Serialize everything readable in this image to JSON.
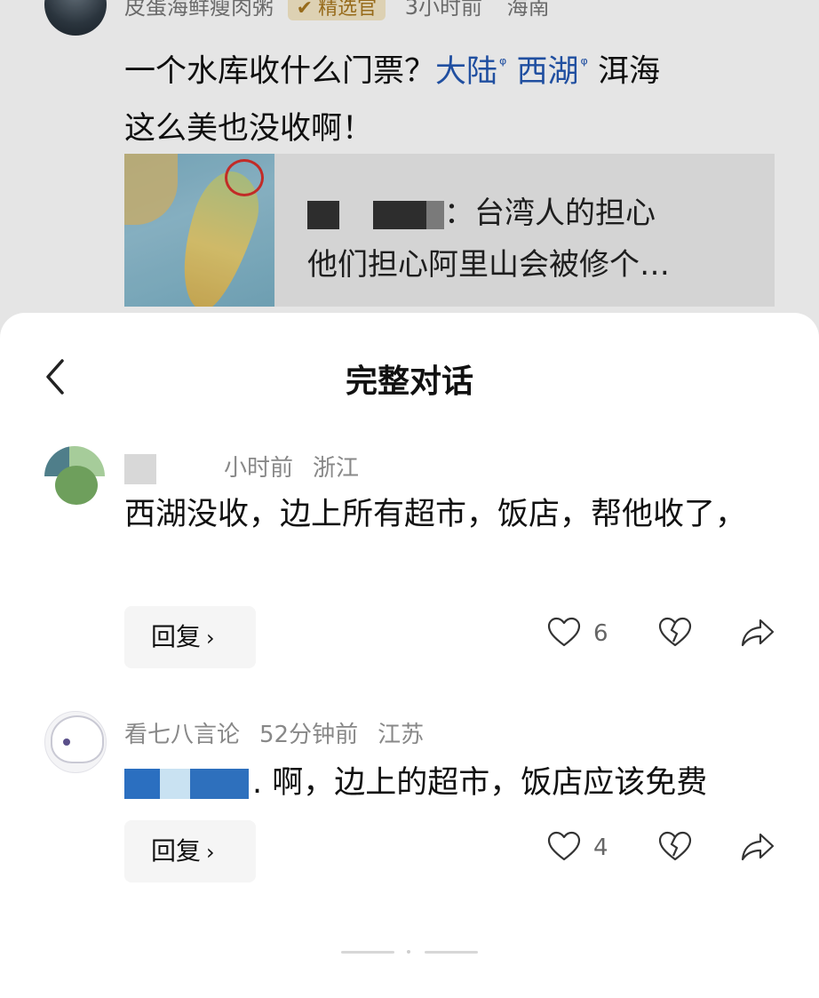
{
  "background_post": {
    "author": "皮蛋海鲜瘦肉粥",
    "badge": "精选官",
    "time": "3小时前",
    "location": "海南",
    "text_before": "一个水库收什么门票？",
    "tags": [
      "大陆",
      "西湖"
    ],
    "text_after_line1": "洱海",
    "text_line2": "这么美也没收啊！",
    "quote_line1": "：台湾人的担心",
    "quote_line2": "他们担心阿里山会被修个…"
  },
  "sheet": {
    "title": "完整对话"
  },
  "comments": [
    {
      "time": "小时前",
      "location": "浙江",
      "text": "西湖没收，边上所有超市，饭店，帮他收了，",
      "reply_label": "回复",
      "likes": "6"
    },
    {
      "author": "看七八言论",
      "time": "52分钟前",
      "location": "江苏",
      "text": ". 啊，边上的超市，饭店应该免费",
      "reply_label": "回复",
      "likes": "4"
    }
  ],
  "icons": {
    "back": "chevron-left-icon",
    "like": "heart-icon",
    "dislike": "broken-heart-icon",
    "share": "share-arrow-icon"
  },
  "colors": {
    "link": "#2458b3",
    "meta": "#888888",
    "reply_bg": "#f5f5f5",
    "badge_bg": "#f6e9c8"
  }
}
